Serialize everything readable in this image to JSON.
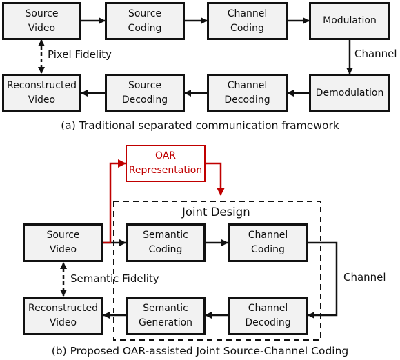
{
  "panel_a": {
    "boxes": {
      "source_video": "Source\nVideo",
      "source_coding": "Source\nCoding",
      "channel_coding": "Channel\nCoding",
      "modulation": "Modulation",
      "reconstructed_video": "Reconstructed\nVideo",
      "source_decoding": "Source\nDecoding",
      "channel_decoding": "Channel\nDecoding",
      "demodulation": "Demodulation"
    },
    "labels": {
      "fidelity": "Pixel Fidelity",
      "channel": "Channel"
    },
    "caption": "(a) Traditional separated communication framework"
  },
  "panel_b": {
    "boxes": {
      "oar": "OAR\nRepresentation",
      "source_video": "Source\nVideo",
      "semantic_coding": "Semantic\nCoding",
      "channel_coding": "Channel\nCoding",
      "reconstructed_video": "Reconstructed\nVideo",
      "semantic_generation": "Semantic\nGeneration",
      "channel_decoding": "Channel\nDecoding"
    },
    "labels": {
      "joint_design": "Joint Design",
      "fidelity": "Semantic Fidelity",
      "channel": "Channel"
    },
    "caption": "(b) Proposed OAR-assisted Joint Source-Channel Coding"
  },
  "colors": {
    "accent_red": "#c00000",
    "box_fill": "#f2f2f2",
    "stroke": "#111111"
  }
}
